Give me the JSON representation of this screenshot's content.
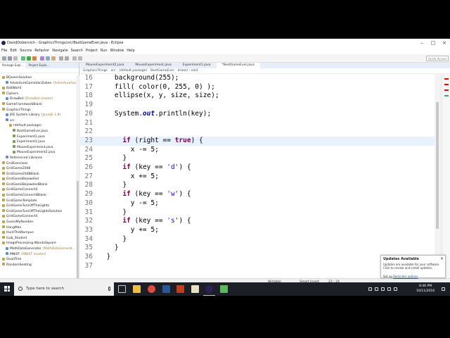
{
  "window": {
    "title": "DavidDobervich - GraphicsThings/src/BestGameEver.java - Eclipse"
  },
  "menu": [
    "File",
    "Edit",
    "Source",
    "Refactor",
    "Navigate",
    "Search",
    "Project",
    "Run",
    "Window",
    "Help"
  ],
  "toolbar": {
    "quick_access_placeholder": "Quick Access"
  },
  "left_panel": {
    "tabs": [
      "Package Expl...",
      "Project Explo..."
    ],
    "tree": [
      {
        "indent": 0,
        "label": "BQueenSolution",
        "extra": ""
      },
      {
        "indent": 1,
        "label": "AdventureGameVanZeben",
        "extra": "[AdventureGame..."
      },
      {
        "indent": 0,
        "label": "BallWorld",
        "extra": ""
      },
      {
        "indent": 0,
        "label": "Ciphers",
        "extra": ""
      },
      {
        "indent": 1,
        "label": "DrawBot",
        "extra": "[DrawBot master]"
      },
      {
        "indent": 0,
        "label": "GameFrameworkBlank",
        "extra": ""
      },
      {
        "indent": 0,
        "label": "GraphicsThings",
        "extra": ""
      },
      {
        "indent": 1,
        "label": "JRE System Library",
        "extra": "[JavaSE-1.8]"
      },
      {
        "indent": 1,
        "label": "src",
        "extra": ""
      },
      {
        "indent": 2,
        "label": "(default package)",
        "extra": ""
      },
      {
        "indent": 3,
        "label": "BestGameEver.java",
        "extra": ""
      },
      {
        "indent": 3,
        "label": "Experiment1.java",
        "extra": ""
      },
      {
        "indent": 3,
        "label": "Experiment2.java",
        "extra": ""
      },
      {
        "indent": 3,
        "label": "MouseExperiment.java",
        "extra": ""
      },
      {
        "indent": 3,
        "label": "MouseExperiment2.java",
        "extra": ""
      },
      {
        "indent": 1,
        "label": "Referenced Libraries",
        "extra": ""
      },
      {
        "indent": 0,
        "label": "GridExercises",
        "extra": ""
      },
      {
        "indent": 0,
        "label": "GridGame2048",
        "extra": ""
      },
      {
        "indent": 0,
        "label": "GridGame2048Blank",
        "extra": ""
      },
      {
        "indent": 0,
        "label": "GridGameBejeweled",
        "extra": ""
      },
      {
        "indent": 0,
        "label": "GridGameBejeweledBlank",
        "extra": ""
      },
      {
        "indent": 0,
        "label": "GridGameConnect4",
        "extra": ""
      },
      {
        "indent": 0,
        "label": "GridGameConnect4Blank",
        "extra": ""
      },
      {
        "indent": 0,
        "label": "GridGameTemplate",
        "extra": ""
      },
      {
        "indent": 0,
        "label": "GridGameTurnOffTheLights",
        "extra": ""
      },
      {
        "indent": 0,
        "label": "GridGameTurnOffTheLightsSolution",
        "extra": ""
      },
      {
        "indent": 0,
        "label": "GridGameConnect4",
        "extra": ""
      },
      {
        "indent": 0,
        "label": "GuessMyNumber",
        "extra": ""
      },
      {
        "indent": 0,
        "label": "HangMan",
        "extra": ""
      },
      {
        "indent": 0,
        "label": "HuntTheWumpus",
        "extra": ""
      },
      {
        "indent": 0,
        "label": "ILab_Student",
        "extra": ""
      },
      {
        "indent": 0,
        "label": "ImageProcessing-WandoSquare",
        "extra": ""
      },
      {
        "indent": 1,
        "label": "MathDataGenerator",
        "extra": "[MathDataGenerat..."
      },
      {
        "indent": 1,
        "label": "MNIST",
        "extra": "[MNIST master]"
      },
      {
        "indent": 0,
        "label": "QuadTree",
        "extra": ""
      },
      {
        "indent": 0,
        "label": "RandomSeating",
        "extra": ""
      }
    ]
  },
  "editor": {
    "tabs": [
      "MouseExperiment2.java",
      "MouseExperiment.java",
      "Experiment1.java",
      "*BestGameEver.java"
    ],
    "active_tab": 3,
    "breadcrumb": [
      "GraphicsThings",
      "src",
      "(default package)",
      "BestGameEver",
      "draw() : void"
    ],
    "current_line": 23,
    "lines": [
      {
        "n": "16",
        "code": "    background(255);"
      },
      {
        "n": "17",
        "code": "    fill( color(0, 255, 0) );"
      },
      {
        "n": "18",
        "code": "    ellipse(x, y, size, size);"
      },
      {
        "n": "19",
        "code": ""
      },
      {
        "n": "20",
        "code": "    System.out.println(key);"
      },
      {
        "n": "21",
        "code": ""
      },
      {
        "n": "22",
        "code": ""
      },
      {
        "n": "23",
        "code": "      if (right == true) {"
      },
      {
        "n": "24",
        "code": "        x -= 5;"
      },
      {
        "n": "25",
        "code": "      }"
      },
      {
        "n": "26",
        "code": "      if (key == 'd') {"
      },
      {
        "n": "27",
        "code": "        x += 5;"
      },
      {
        "n": "28",
        "code": "      }"
      },
      {
        "n": "29",
        "code": "      if (key == 'w') {"
      },
      {
        "n": "30",
        "code": "        y -= 5;"
      },
      {
        "n": "31",
        "code": "      }"
      },
      {
        "n": "32",
        "code": "      if (key == 's') {"
      },
      {
        "n": "33",
        "code": "        y += 5;"
      },
      {
        "n": "34",
        "code": "      }"
      },
      {
        "n": "35",
        "code": "    }"
      },
      {
        "n": "36",
        "code": "  }"
      },
      {
        "n": "37",
        "code": ""
      }
    ]
  },
  "status": {
    "writable": "Writable",
    "insert_mode": "Smart Insert",
    "position": "23 : 24"
  },
  "notification": {
    "title": "Updates Available",
    "body": "Updates are available for your software. Click to review and install updates.",
    "link_prefix": "Set up ",
    "link_text": "Reminder options"
  },
  "taskbar": {
    "search_placeholder": "Type here to search",
    "time": "8:46 PM",
    "date": "10/11/2018"
  },
  "colors": {
    "keyword": "#7f0055",
    "string_literal": "#2a00ff",
    "static_field": "#0000c0",
    "current_line": "#e8f2fe",
    "taskbar": "#1c1f26"
  }
}
